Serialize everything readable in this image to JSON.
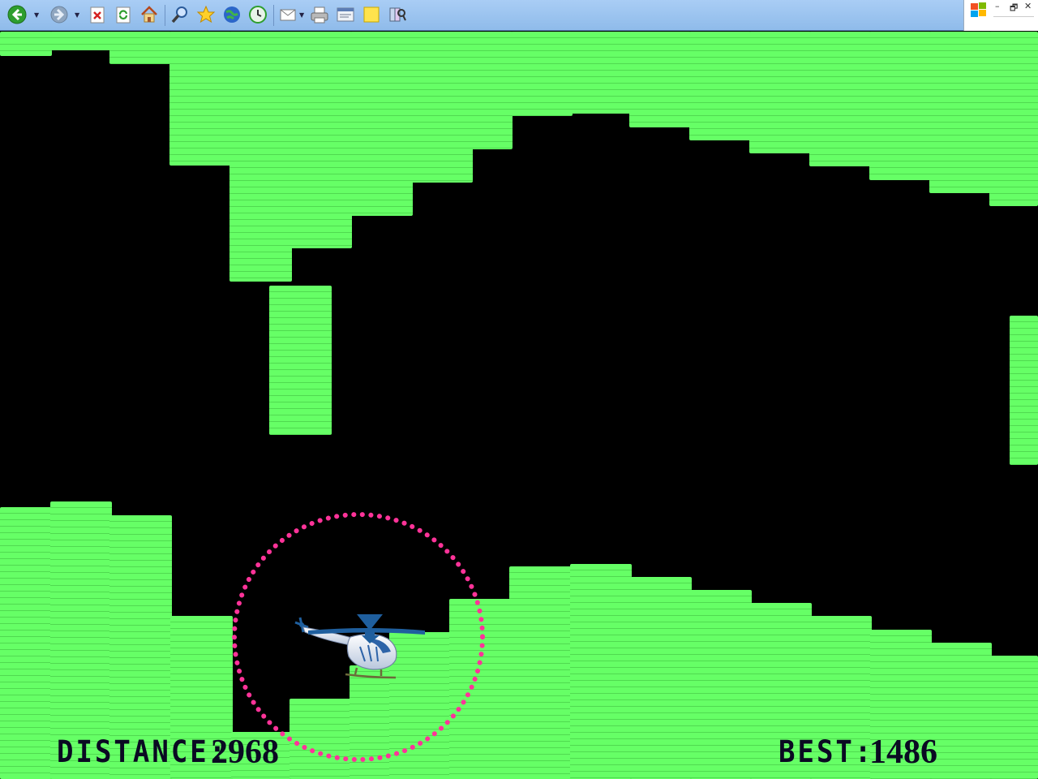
{
  "toolbar": {
    "buttons": [
      {
        "name": "back-icon"
      },
      {
        "name": "forward-icon"
      },
      {
        "name": "stop-icon"
      },
      {
        "name": "refresh-icon"
      },
      {
        "name": "home-icon"
      },
      {
        "name": "search-icon"
      },
      {
        "name": "favorites-icon"
      },
      {
        "name": "media-icon"
      },
      {
        "name": "history-icon"
      },
      {
        "name": "mail-icon"
      },
      {
        "name": "print-icon"
      },
      {
        "name": "edit-icon"
      },
      {
        "name": "notes-icon"
      },
      {
        "name": "research-icon"
      }
    ]
  },
  "window_controls": {
    "minimize": "–",
    "restore": "🗗",
    "close": "✕"
  },
  "game": {
    "colors": {
      "cave": "#66ff66",
      "background": "#000000",
      "target_ring": "#ff3399",
      "hud_text": "#0a0a22"
    },
    "hud": {
      "distance_label": "DISTANCE:",
      "distance_value": "2968",
      "best_label": "BEST:",
      "best_value": "1486"
    }
  }
}
